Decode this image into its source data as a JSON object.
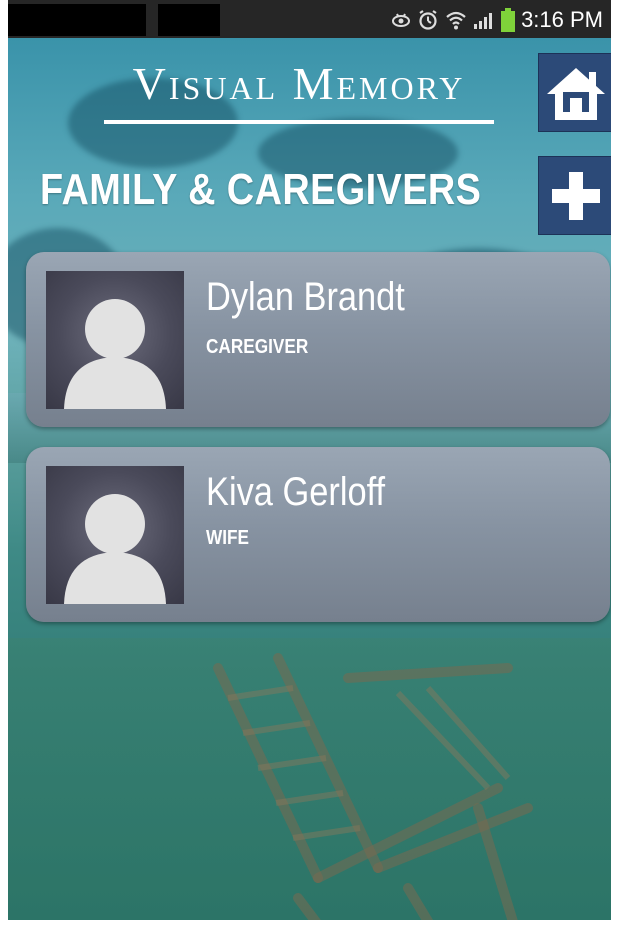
{
  "status_bar": {
    "time": "3:16 PM",
    "icons": [
      "eye-icon",
      "alarm-icon",
      "wifi-icon",
      "signal-icon",
      "battery-icon"
    ]
  },
  "header": {
    "logo_text": "Visual Memory",
    "home_icon": "home-icon"
  },
  "section": {
    "title": "FAMILY & CAREGIVERS",
    "add_icon": "plus-icon"
  },
  "contacts": [
    {
      "name": "Dylan Brandt",
      "role": "CAREGIVER"
    },
    {
      "name": "Kiva Gerloff",
      "role": "WIFE"
    }
  ],
  "colors": {
    "button_blue": "#2c4a78",
    "card_gray": "#8793a2",
    "text_white": "#ffffff"
  }
}
